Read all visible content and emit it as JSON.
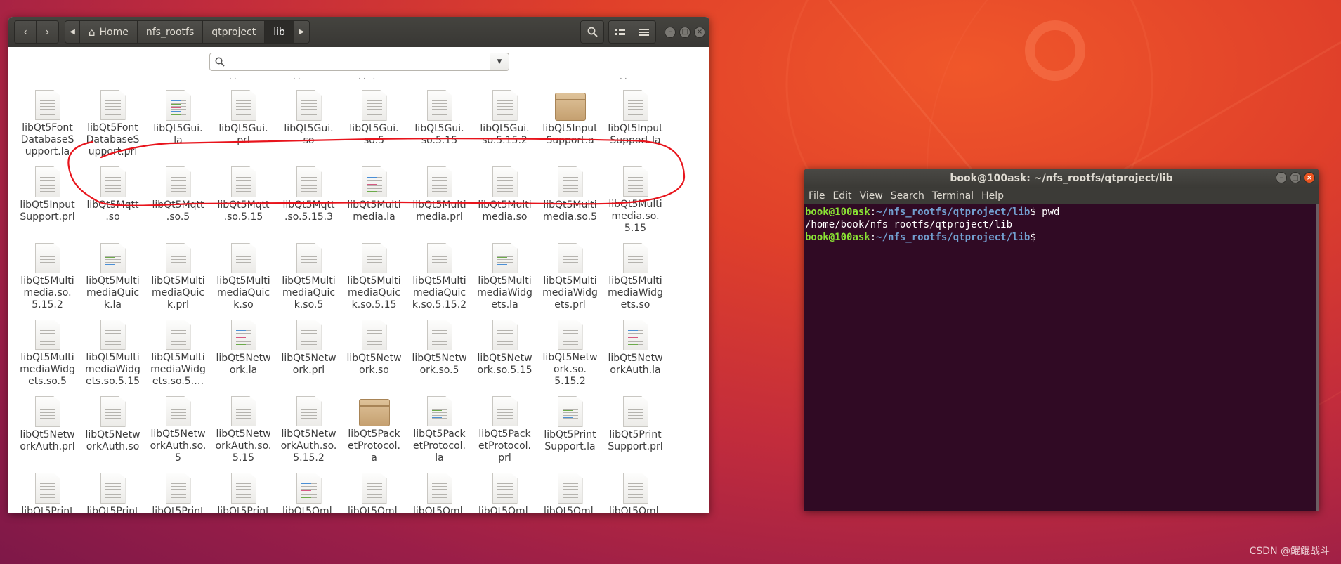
{
  "file_manager": {
    "nav": {
      "back_icon": "chevron-left-icon",
      "forward_icon": "chevron-right-icon"
    },
    "breadcrumbs": [
      "Home",
      "nfs_rootfs",
      "qtproject",
      "lib"
    ],
    "search": {
      "value": "",
      "placeholder": ""
    },
    "files": [
      {
        "name": "libQt5Font\nDatabaseS\nupport.la",
        "icon": "text-file-icon"
      },
      {
        "name": "libQt5Font\nDatabaseS\nupport.prl",
        "icon": "text-file-icon"
      },
      {
        "name": "libQt5Gui.\nla",
        "icon": "text-file-colored-icon"
      },
      {
        "name": "libQt5Gui.\nprl",
        "icon": "text-file-icon"
      },
      {
        "name": "libQt5Gui.\nso",
        "icon": "text-file-icon"
      },
      {
        "name": "libQt5Gui.\nso.5",
        "icon": "text-file-icon"
      },
      {
        "name": "libQt5Gui.\nso.5.15",
        "icon": "text-file-icon"
      },
      {
        "name": "libQt5Gui.\nso.5.15.2",
        "icon": "text-file-icon"
      },
      {
        "name": "libQt5Input\nSupport.a",
        "icon": "package-icon"
      },
      {
        "name": "libQt5Input\nSupport.la",
        "icon": "text-file-icon"
      },
      {
        "name": "libQt5Input\nSupport.prl",
        "icon": "text-file-icon"
      },
      {
        "name": "libQt5Mqtt\n.so",
        "icon": "text-file-icon"
      },
      {
        "name": "libQt5Mqtt\n.so.5",
        "icon": "text-file-icon"
      },
      {
        "name": "libQt5Mqtt\n.so.5.15",
        "icon": "text-file-icon"
      },
      {
        "name": "libQt5Mqtt\n.so.5.15.3",
        "icon": "text-file-icon"
      },
      {
        "name": "libQt5Multi\nmedia.la",
        "icon": "text-file-colored-icon"
      },
      {
        "name": "libQt5Multi\nmedia.prl",
        "icon": "text-file-icon"
      },
      {
        "name": "libQt5Multi\nmedia.so",
        "icon": "text-file-icon"
      },
      {
        "name": "libQt5Multi\nmedia.so.5",
        "icon": "text-file-icon"
      },
      {
        "name": "libQt5Multi\nmedia.so.\n5.15",
        "icon": "text-file-icon"
      },
      {
        "name": "libQt5Multi\nmedia.so.\n5.15.2",
        "icon": "text-file-icon"
      },
      {
        "name": "libQt5Multi\nmediaQuic\nk.la",
        "icon": "text-file-colored-icon"
      },
      {
        "name": "libQt5Multi\nmediaQuic\nk.prl",
        "icon": "text-file-icon"
      },
      {
        "name": "libQt5Multi\nmediaQuic\nk.so",
        "icon": "text-file-icon"
      },
      {
        "name": "libQt5Multi\nmediaQuic\nk.so.5",
        "icon": "text-file-icon"
      },
      {
        "name": "libQt5Multi\nmediaQuic\nk.so.5.15",
        "icon": "text-file-icon"
      },
      {
        "name": "libQt5Multi\nmediaQuic\nk.so.5.15.2",
        "icon": "text-file-icon"
      },
      {
        "name": "libQt5Multi\nmediaWidg\nets.la",
        "icon": "text-file-colored-icon"
      },
      {
        "name": "libQt5Multi\nmediaWidg\nets.prl",
        "icon": "text-file-icon"
      },
      {
        "name": "libQt5Multi\nmediaWidg\nets.so",
        "icon": "text-file-icon"
      },
      {
        "name": "libQt5Multi\nmediaWidg\nets.so.5",
        "icon": "text-file-icon"
      },
      {
        "name": "libQt5Multi\nmediaWidg\nets.so.5.15",
        "icon": "text-file-icon"
      },
      {
        "name": "libQt5Multi\nmediaWidg\nets.so.5.…",
        "icon": "text-file-icon"
      },
      {
        "name": "libQt5Netw\nork.la",
        "icon": "text-file-colored-icon"
      },
      {
        "name": "libQt5Netw\nork.prl",
        "icon": "text-file-icon"
      },
      {
        "name": "libQt5Netw\nork.so",
        "icon": "text-file-icon"
      },
      {
        "name": "libQt5Netw\nork.so.5",
        "icon": "text-file-icon"
      },
      {
        "name": "libQt5Netw\nork.so.5.15",
        "icon": "text-file-icon"
      },
      {
        "name": "libQt5Netw\nork.so.\n5.15.2",
        "icon": "text-file-icon"
      },
      {
        "name": "libQt5Netw\norkAuth.la",
        "icon": "text-file-colored-icon"
      },
      {
        "name": "libQt5Netw\norkAuth.prl",
        "icon": "text-file-icon"
      },
      {
        "name": "libQt5Netw\norkAuth.so",
        "icon": "text-file-icon"
      },
      {
        "name": "libQt5Netw\norkAuth.so.\n5",
        "icon": "text-file-icon"
      },
      {
        "name": "libQt5Netw\norkAuth.so.\n5.15",
        "icon": "text-file-icon"
      },
      {
        "name": "libQt5Netw\norkAuth.so.\n5.15.2",
        "icon": "text-file-icon"
      },
      {
        "name": "libQt5Pack\netProtocol.\na",
        "icon": "package-icon"
      },
      {
        "name": "libQt5Pack\netProtocol.\nla",
        "icon": "text-file-colored-icon"
      },
      {
        "name": "libQt5Pack\netProtocol.\nprl",
        "icon": "text-file-icon"
      },
      {
        "name": "libQt5Print\nSupport.la",
        "icon": "text-file-colored-icon"
      },
      {
        "name": "libQt5Print\nSupport.prl",
        "icon": "text-file-icon"
      },
      {
        "name": "libQt5Print",
        "icon": "text-file-icon"
      },
      {
        "name": "libQt5Print",
        "icon": "text-file-icon"
      },
      {
        "name": "libQt5Print",
        "icon": "text-file-icon"
      },
      {
        "name": "libQt5Print",
        "icon": "text-file-icon"
      },
      {
        "name": "libQt5Qml.",
        "icon": "text-file-colored-icon"
      },
      {
        "name": "libQt5Qml.",
        "icon": "text-file-icon"
      },
      {
        "name": "libQt5Qml.",
        "icon": "text-file-icon"
      },
      {
        "name": "libQt5Qml.",
        "icon": "text-file-icon"
      },
      {
        "name": "libQt5Qml.",
        "icon": "text-file-icon"
      },
      {
        "name": "libQt5Qml.",
        "icon": "text-file-icon"
      }
    ]
  },
  "terminal": {
    "title": "book@100ask: ~/nfs_rootfs/qtproject/lib",
    "menu": [
      "File",
      "Edit",
      "View",
      "Search",
      "Terminal",
      "Help"
    ],
    "lines": [
      {
        "user": "book@100ask",
        "sep": ":",
        "path": "~/nfs_rootfs/qtproject/lib",
        "prompt": "$ ",
        "cmd": "pwd"
      },
      {
        "output": "/home/book/nfs_rootfs/qtproject/lib"
      },
      {
        "user": "book@100ask",
        "sep": ":",
        "path": "~/nfs_rootfs/qtproject/lib",
        "prompt": "$ ",
        "cmd": ""
      }
    ]
  },
  "watermark": "CSDN @鲲鲲战斗",
  "colors": {
    "annotation": "#e8141c",
    "terminal_bg": "#300a24",
    "prompt_user": "#8ae234",
    "prompt_path": "#729fcf"
  }
}
